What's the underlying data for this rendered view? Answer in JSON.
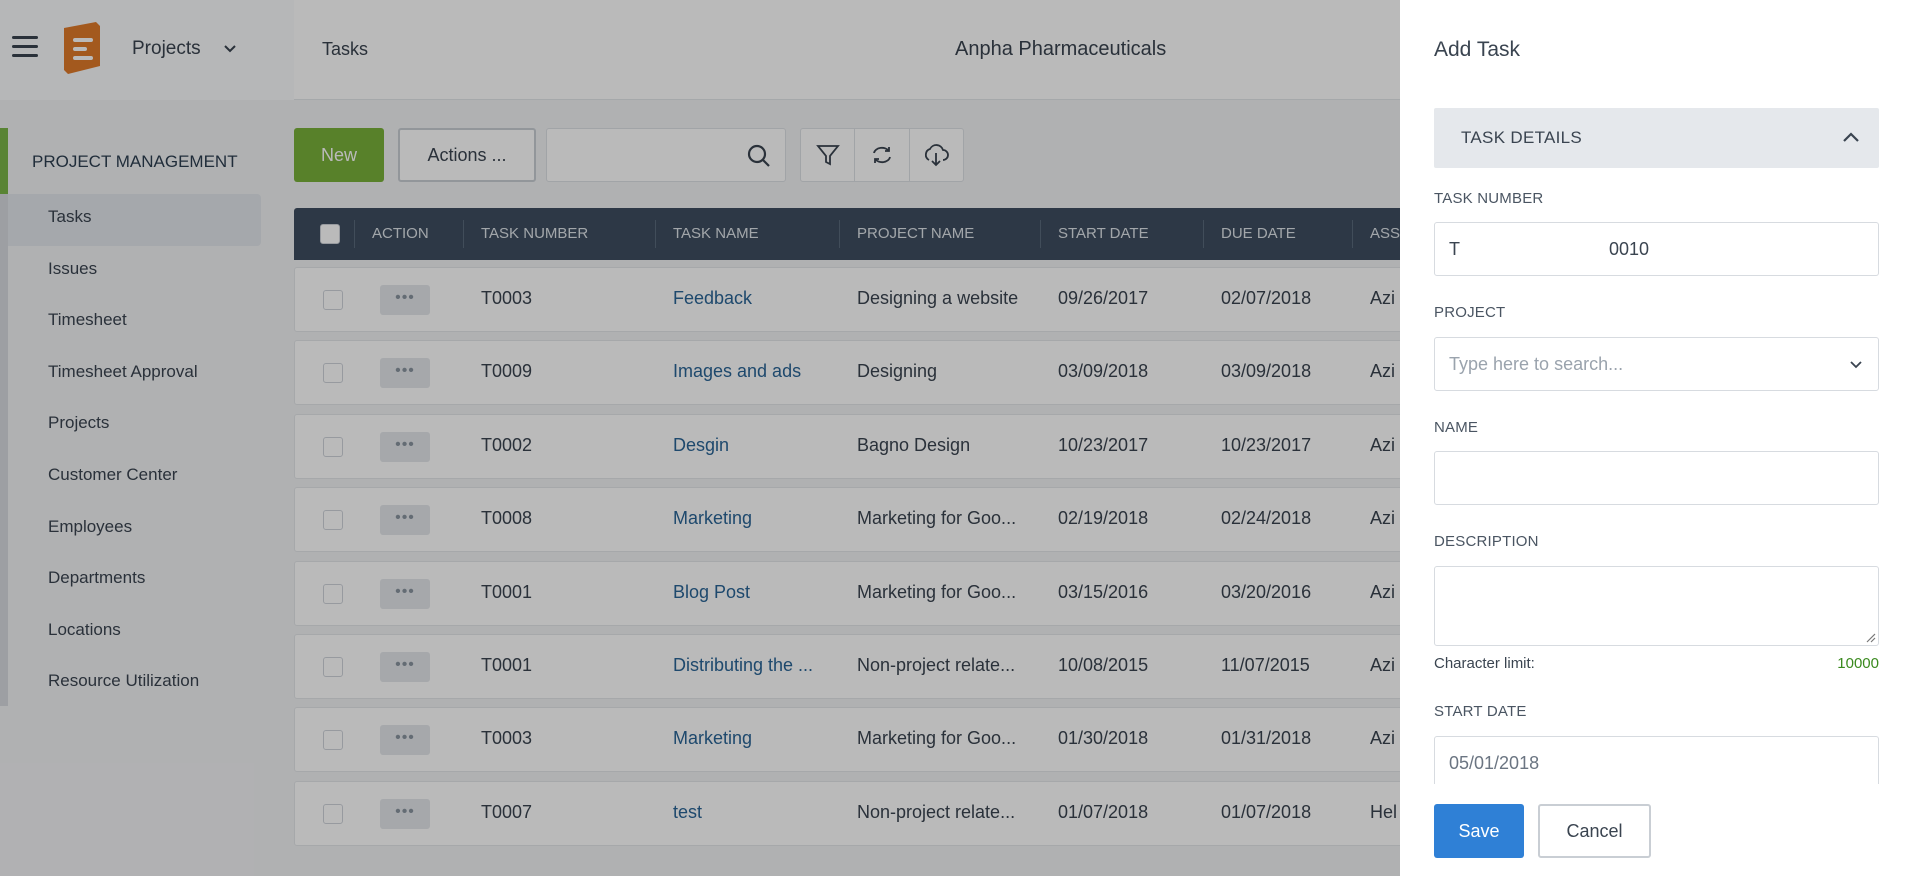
{
  "header": {
    "app_name": "Projects",
    "breadcrumb": "Tasks",
    "company": "Anpha Pharmaceuticals"
  },
  "sidebar": {
    "section": "PROJECT MANAGEMENT",
    "items": [
      {
        "label": "Tasks",
        "active": true
      },
      {
        "label": "Issues"
      },
      {
        "label": "Timesheet"
      },
      {
        "label": "Timesheet Approval"
      },
      {
        "label": "Projects"
      },
      {
        "label": "Customer Center"
      },
      {
        "label": "Employees"
      },
      {
        "label": "Departments"
      },
      {
        "label": "Locations"
      },
      {
        "label": "Resource Utilization"
      }
    ]
  },
  "toolbar": {
    "new_label": "New",
    "actions_label": "Actions ...",
    "search_placeholder": ""
  },
  "table": {
    "columns": [
      "ACTION",
      "TASK NUMBER",
      "TASK NAME",
      "PROJECT NAME",
      "START DATE",
      "DUE DATE",
      "ASS"
    ],
    "rows": [
      {
        "number": "T0003",
        "name": "Feedback",
        "project": "Designing a website",
        "start": "09/26/2017",
        "due": "02/07/2018",
        "assignee": "Azi"
      },
      {
        "number": "T0009",
        "name": "Images and ads",
        "project": "Designing",
        "start": "03/09/2018",
        "due": "03/09/2018",
        "assignee": "Azi"
      },
      {
        "number": "T0002",
        "name": "Desgin",
        "project": "Bagno Design",
        "start": "10/23/2017",
        "due": "10/23/2017",
        "assignee": "Azi"
      },
      {
        "number": "T0008",
        "name": "Marketing",
        "project": "Marketing for Goo...",
        "start": "02/19/2018",
        "due": "02/24/2018",
        "assignee": "Azi"
      },
      {
        "number": "T0001",
        "name": "Blog Post",
        "project": "Marketing for Goo...",
        "start": "03/15/2016",
        "due": "03/20/2016",
        "assignee": "Azi"
      },
      {
        "number": "T0001",
        "name": "Distributing the ...",
        "project": "Non-project relate...",
        "start": "10/08/2015",
        "due": "11/07/2015",
        "assignee": "Azi"
      },
      {
        "number": "T0003",
        "name": "Marketing",
        "project": "Marketing for Goo...",
        "start": "01/30/2018",
        "due": "01/31/2018",
        "assignee": "Azi"
      },
      {
        "number": "T0007",
        "name": "test",
        "project": "Non-project relate...",
        "start": "01/07/2018",
        "due": "01/07/2018",
        "assignee": "Hel"
      }
    ],
    "action_glyph": "•••"
  },
  "panel": {
    "title": "Add Task",
    "section_label": "TASK DETAILS",
    "task_number_label": "TASK NUMBER",
    "task_prefix": "T",
    "task_number": "0010",
    "project_label": "PROJECT",
    "project_placeholder": "Type here to search...",
    "name_label": "NAME",
    "name_value": "",
    "description_label": "DESCRIPTION",
    "char_limit_label": "Character limit:",
    "char_limit_value": "10000",
    "start_date_label": "START DATE",
    "start_date_value": "05/01/2018",
    "save_label": "Save",
    "cancel_label": "Cancel"
  },
  "colors": {
    "accent_green": "#79b13a",
    "primary_blue": "#2f80d6",
    "table_header": "#3e4e60",
    "link": "#2a6496",
    "char_limit_green": "#3a8a1e"
  }
}
